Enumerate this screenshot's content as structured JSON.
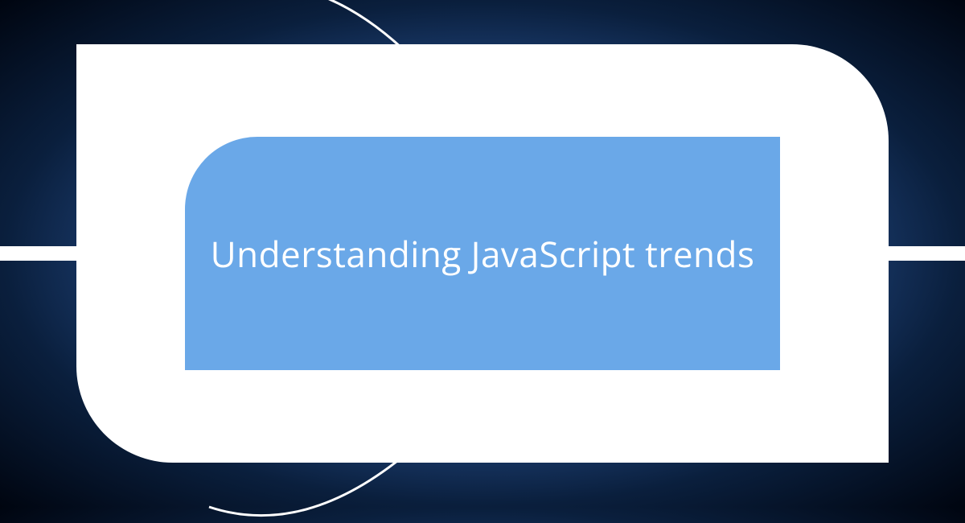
{
  "title": "Understanding JavaScript trends",
  "colors": {
    "background_gradient_center": "#5a8fd8",
    "background_gradient_edge": "#000510",
    "frame": "#ffffff",
    "inner_panel": "#6aa8e8",
    "title_text": "#ffffff"
  }
}
